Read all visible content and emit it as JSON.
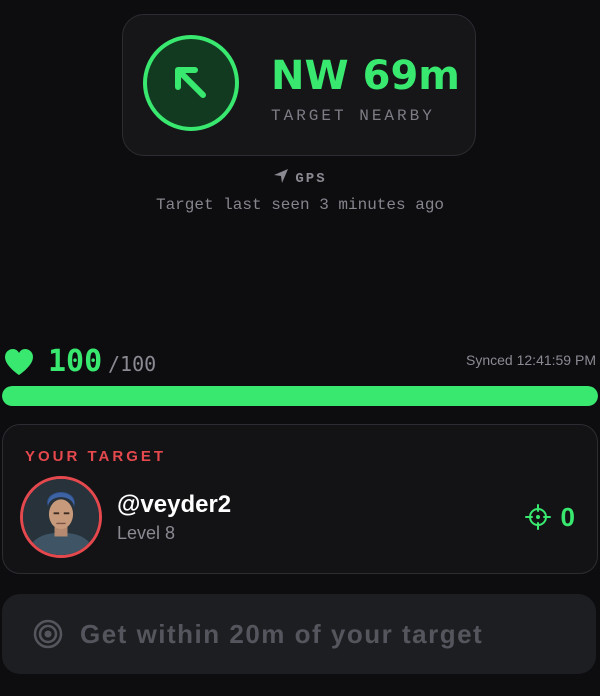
{
  "compass": {
    "direction": "NW",
    "distance": "69m",
    "status": "TARGET NEARBY",
    "arrow_icon": "arrow-up-left-icon",
    "accent_color": "#39e86f"
  },
  "location": {
    "source_label": "GPS",
    "source_icon": "navigation-arrow-icon",
    "last_seen": "Target last seen 3 minutes ago"
  },
  "health": {
    "icon": "heart-icon",
    "current": "100",
    "max": "/100",
    "fraction": 1.0,
    "synced": "Synced 12:41:59 PM"
  },
  "target": {
    "heading": "YOUR TARGET",
    "heading_color": "#e5484d",
    "username": "@veyder2",
    "level": "Level 8",
    "kills_icon": "crosshair-icon",
    "kills": "0"
  },
  "action": {
    "icon": "target-rings-icon",
    "label": "Get within 20m of your target"
  }
}
